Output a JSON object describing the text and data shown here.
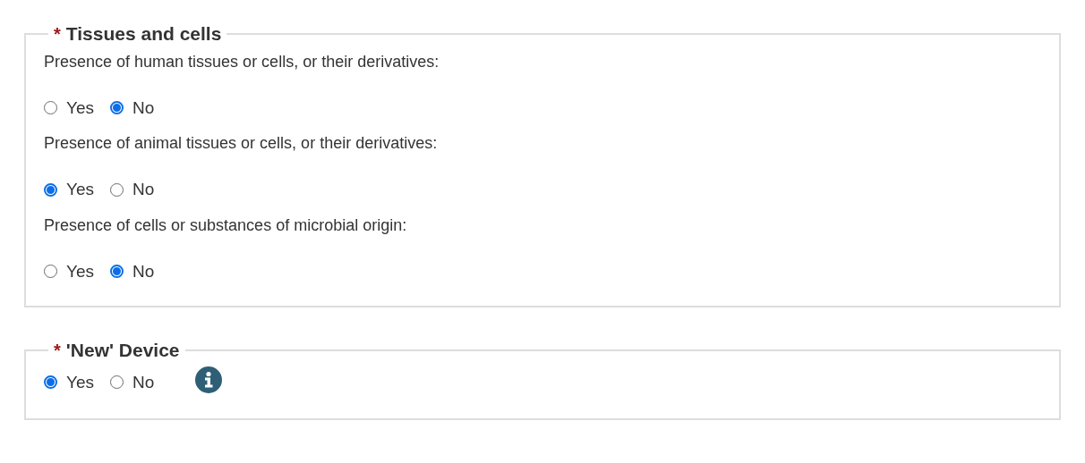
{
  "sections": [
    {
      "required_mark": "*",
      "title": "Tissues and cells",
      "questions": [
        {
          "label": "Presence of human tissues or cells, or their derivatives:",
          "options": [
            {
              "label": "Yes",
              "selected": false
            },
            {
              "label": "No",
              "selected": true
            }
          ]
        },
        {
          "label": "Presence of animal tissues or cells, or their derivatives:",
          "options": [
            {
              "label": "Yes",
              "selected": true
            },
            {
              "label": "No",
              "selected": false
            }
          ]
        },
        {
          "label": "Presence of cells or substances of microbial origin:",
          "options": [
            {
              "label": "Yes",
              "selected": false
            },
            {
              "label": "No",
              "selected": true
            }
          ]
        }
      ]
    },
    {
      "required_mark": "*",
      "title": "'New' Device",
      "info": true,
      "questions": [
        {
          "options": [
            {
              "label": "Yes",
              "selected": true
            },
            {
              "label": "No",
              "selected": false
            }
          ]
        }
      ]
    }
  ]
}
